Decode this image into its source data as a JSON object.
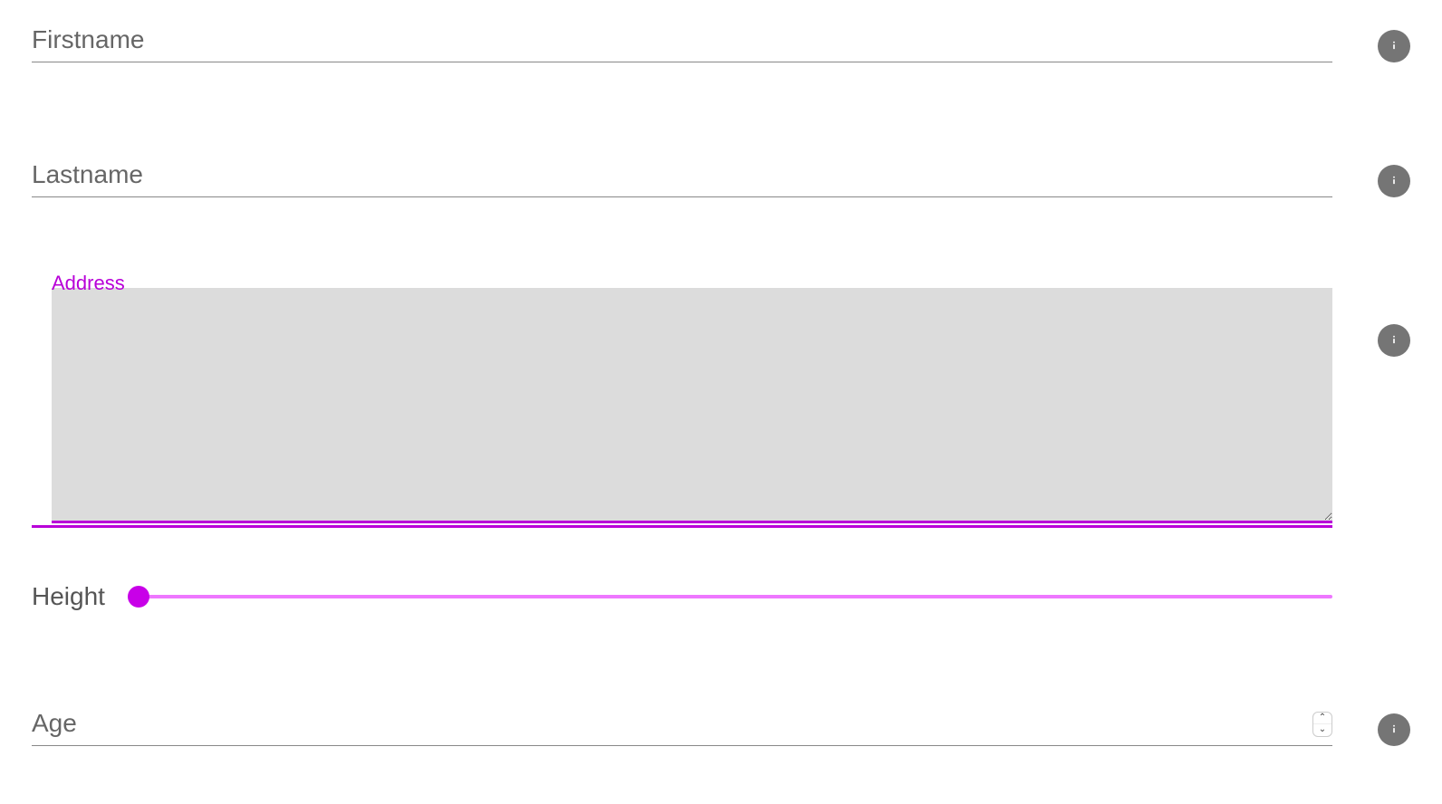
{
  "fields": {
    "firstname": {
      "placeholder": "Firstname",
      "value": ""
    },
    "lastname": {
      "placeholder": "Lastname",
      "value": ""
    },
    "address": {
      "label": "Address",
      "value": ""
    },
    "height": {
      "label": "Height",
      "value": 0
    },
    "age": {
      "placeholder": "Age",
      "value": ""
    }
  },
  "colors": {
    "accent": "#b800d8",
    "sliderTrack": "#ee77ff",
    "infoButton": "#757575"
  }
}
